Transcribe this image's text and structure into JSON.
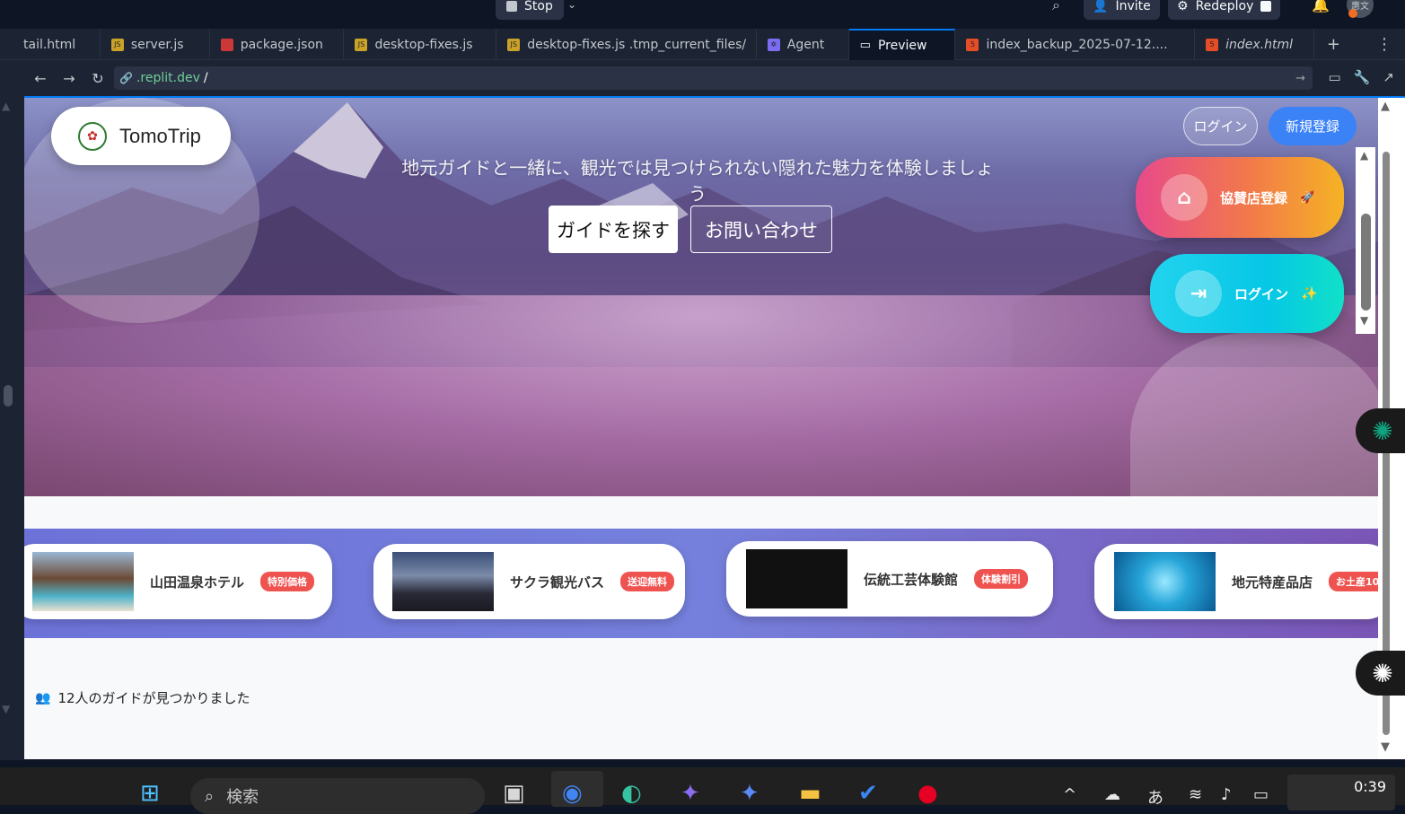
{
  "topbar": {
    "stop_label": "Stop",
    "invite_label": "Invite",
    "redeploy_label": "Redeploy",
    "avatar_text": "惠文"
  },
  "tabs": [
    {
      "label": "tail.html",
      "icon": "html-file-icon",
      "icon_color": "#e44d26"
    },
    {
      "label": "server.js",
      "icon": "js-file-icon",
      "icon_color": "#c9a227"
    },
    {
      "label": "package.json",
      "icon": "json-file-icon",
      "icon_color": "#cb3837"
    },
    {
      "label": "desktop-fixes.js",
      "icon": "js-file-icon",
      "icon_color": "#c9a227"
    },
    {
      "label": "desktop-fixes.js .tmp_current_files/",
      "icon": "js-file-icon",
      "icon_color": "#c9a227"
    },
    {
      "label": "Agent",
      "icon": "agent-icon",
      "icon_color": "#7c6cf0"
    },
    {
      "label": "Preview",
      "icon": "monitor-icon",
      "icon_color": "#f5f9fc"
    },
    {
      "label": "index_backup_2025-07-12....",
      "icon": "html-file-icon",
      "icon_color": "#e44d26"
    },
    {
      "label": "index.html",
      "icon": "html-file-icon",
      "icon_color": "#e44d26"
    }
  ],
  "url": {
    "host": ".replit.dev",
    "path": "/"
  },
  "site": {
    "brand": "TomoTrip",
    "subtitle": "地元ガイドと一緒に、観光では見つけられない隠れた魅力を体験しましょう",
    "find_guide": "ガイドを探す",
    "contact": "お問い合わせ",
    "login_small": "ログイン",
    "signup": "新規登録",
    "sponsor_register": "協賛店登録",
    "login_big": "ログイン",
    "guides_found": "12人のガイドが見つかりました"
  },
  "sponsors": [
    {
      "name": "山田温泉ホテル",
      "badge": "特別価格"
    },
    {
      "name": "サクラ観光バス",
      "badge": "送迎無料"
    },
    {
      "name": "伝統工芸体験館",
      "badge": "体験割引"
    },
    {
      "name": "地元特産品店",
      "badge": "お土産10"
    }
  ],
  "taskbar": {
    "search_label": "検索",
    "ime": "あ",
    "time": "0:39"
  },
  "colors": {
    "accent": "#0079f2",
    "signup_blue": "#3b82f6",
    "badge_red": "#ef5350"
  }
}
